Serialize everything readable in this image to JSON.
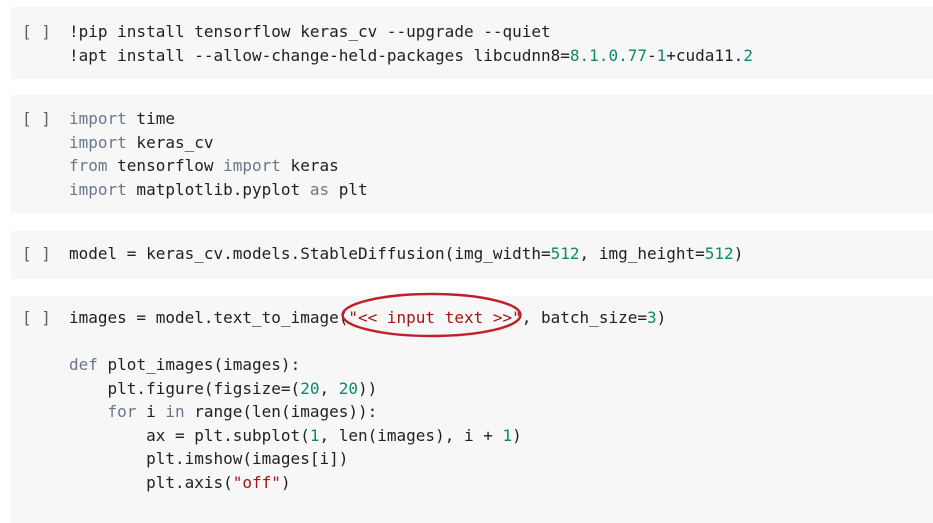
{
  "run_indicator": "[ ]",
  "cells": [
    {
      "lines": [
        {
          "tokens": [
            {
              "text": "!pip install tensorflow keras_cv --upgrade --quiet"
            }
          ]
        },
        {
          "tokens": [
            {
              "text": "!apt install --allow-change-held-packages libcudnn8="
            },
            {
              "text": "8.1.0.77",
              "style": "num"
            },
            {
              "text": "-"
            },
            {
              "text": "1",
              "style": "num"
            },
            {
              "text": "+cuda11."
            },
            {
              "text": "2",
              "style": "num"
            }
          ]
        }
      ]
    },
    {
      "lines": [
        {
          "tokens": [
            {
              "text": "import",
              "style": "kw"
            },
            {
              "text": " time"
            }
          ]
        },
        {
          "tokens": [
            {
              "text": "import",
              "style": "kw"
            },
            {
              "text": " keras_cv"
            }
          ]
        },
        {
          "tokens": [
            {
              "text": "from",
              "style": "kw"
            },
            {
              "text": " tensorflow "
            },
            {
              "text": "import",
              "style": "kw"
            },
            {
              "text": " keras"
            }
          ]
        },
        {
          "tokens": [
            {
              "text": "import",
              "style": "kw"
            },
            {
              "text": " matplotlib.pyplot "
            },
            {
              "text": "as",
              "style": "kw"
            },
            {
              "text": " plt"
            }
          ]
        }
      ]
    },
    {
      "lines": [
        {
          "tokens": [
            {
              "text": "model = keras_cv.models.StableDiffusion(img_width="
            },
            {
              "text": "512",
              "style": "num"
            },
            {
              "text": ", img_height="
            },
            {
              "text": "512",
              "style": "num"
            },
            {
              "text": ")"
            }
          ]
        }
      ]
    },
    {
      "lines": [
        {
          "tokens": [
            {
              "text": "images = model.text_to_image("
            },
            {
              "text": "\"<< input text >>\"",
              "style": "str"
            },
            {
              "text": ", batch_size="
            },
            {
              "text": "3",
              "style": "num"
            },
            {
              "text": ")"
            }
          ]
        },
        {
          "tokens": [
            {
              "text": ""
            }
          ]
        },
        {
          "tokens": [
            {
              "text": "def",
              "style": "kw"
            },
            {
              "text": " plot_images(images):"
            }
          ]
        },
        {
          "tokens": [
            {
              "text": "    plt.figure(figsize=("
            },
            {
              "text": "20",
              "style": "num"
            },
            {
              "text": ", "
            },
            {
              "text": "20",
              "style": "num"
            },
            {
              "text": "))"
            }
          ]
        },
        {
          "tokens": [
            {
              "text": "    "
            },
            {
              "text": "for",
              "style": "kw"
            },
            {
              "text": " i "
            },
            {
              "text": "in",
              "style": "kw"
            },
            {
              "text": " range(len(images)):"
            }
          ]
        },
        {
          "tokens": [
            {
              "text": "        ax = plt.subplot("
            },
            {
              "text": "1",
              "style": "num"
            },
            {
              "text": ", len(images), i + "
            },
            {
              "text": "1",
              "style": "num"
            },
            {
              "text": ")"
            }
          ]
        },
        {
          "tokens": [
            {
              "text": "        plt.imshow(images[i])"
            }
          ]
        },
        {
          "tokens": [
            {
              "text": "        plt.axis("
            },
            {
              "text": "\"off\"",
              "style": "str"
            },
            {
              "text": ")"
            }
          ]
        }
      ]
    }
  ],
  "colors": {
    "cell_background": "#f7f7f7",
    "code_text": "#212121",
    "keyword": "#6a7789",
    "number": "#0a8a6a",
    "string": "#a31515",
    "annotation_circle": "#c0202a"
  }
}
